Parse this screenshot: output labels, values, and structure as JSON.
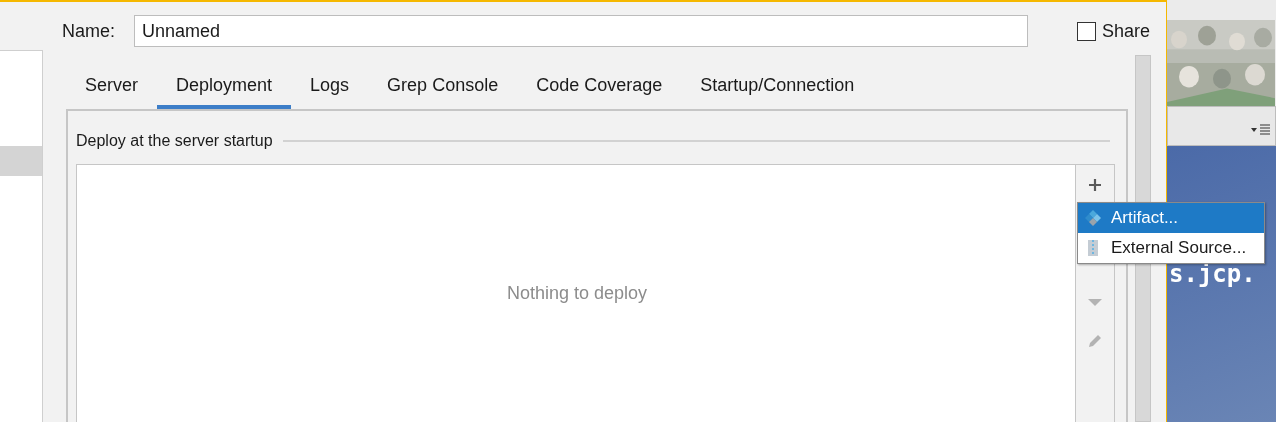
{
  "sidebar": {
    "rows": [
      {
        "selected": true
      }
    ]
  },
  "name_field": {
    "label": "Name:",
    "value": "Unnamed"
  },
  "share": {
    "label": "Share",
    "checked": false
  },
  "tabs": [
    {
      "label": "Server",
      "selected": false
    },
    {
      "label": "Deployment",
      "selected": true
    },
    {
      "label": "Logs",
      "selected": false
    },
    {
      "label": "Grep Console",
      "selected": false
    },
    {
      "label": "Code Coverage",
      "selected": false
    },
    {
      "label": "Startup/Connection",
      "selected": false
    }
  ],
  "deploy_section": {
    "title": "Deploy at the server startup",
    "empty_text": "Nothing to deploy",
    "toolbar": [
      {
        "kind": "add",
        "disabled": false
      },
      {
        "kind": "move_down",
        "disabled": true
      },
      {
        "kind": "edit",
        "disabled": true
      }
    ]
  },
  "popup_menu": [
    {
      "kind": "artifact",
      "label": "Artifact...",
      "selected": true
    },
    {
      "kind": "external",
      "label": "External Source...",
      "selected": false
    }
  ],
  "background_window": {
    "text": "s.jcp."
  }
}
